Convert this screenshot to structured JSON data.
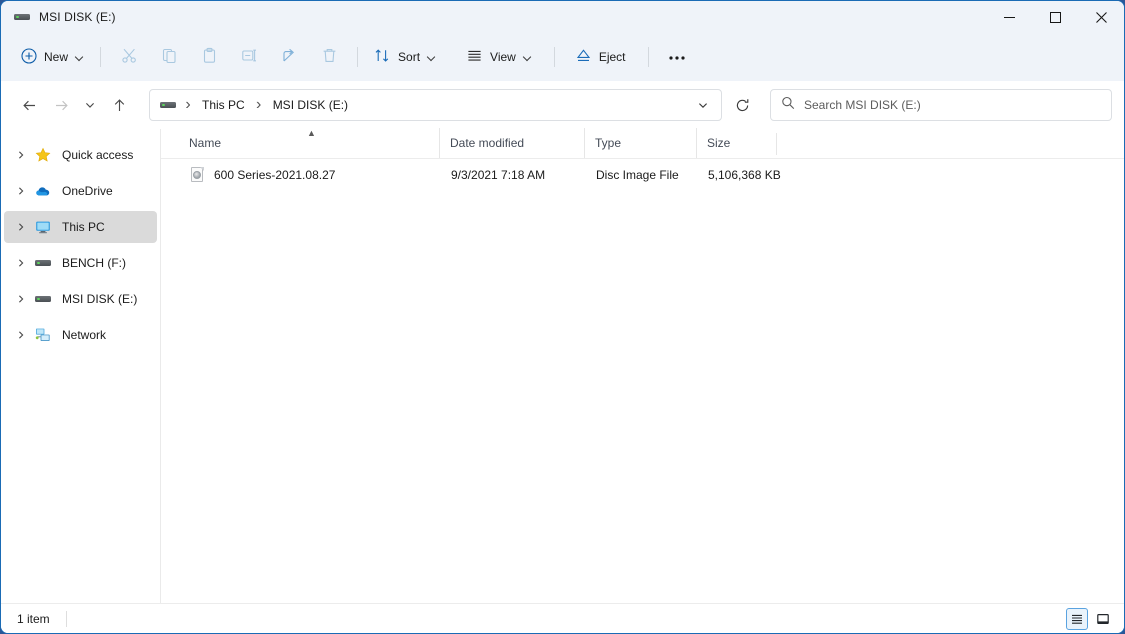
{
  "window": {
    "title": "MSI DISK (E:)",
    "title_icon": "drive-icon",
    "minimize_label": "Minimize",
    "maximize_label": "Maximize",
    "close_label": "Close"
  },
  "toolbar": {
    "new_label": "New",
    "new_icon": "plus-circle-icon",
    "cut_label": "Cut",
    "cut_icon": "scissors-icon",
    "copy_label": "Copy",
    "copy_icon": "copy-icon",
    "paste_label": "Paste",
    "paste_icon": "clipboard-icon",
    "rename_label": "Rename",
    "rename_icon": "rename-icon",
    "share_label": "Share",
    "share_icon": "share-icon",
    "delete_label": "Delete",
    "delete_icon": "trash-icon",
    "sort_label": "Sort",
    "sort_icon": "sort-arrows-icon",
    "view_label": "View",
    "view_icon": "lines-icon",
    "eject_label": "Eject",
    "eject_icon": "eject-icon",
    "more_label": "See more",
    "more_icon": "ellipsis-icon"
  },
  "address": {
    "back_icon": "arrow-left-icon",
    "forward_icon": "arrow-right-icon",
    "recent_icon": "chevron-down-icon",
    "up_icon": "arrow-up-icon",
    "crumb_icon": "drive-icon",
    "crumbs": [
      "This PC",
      "MSI DISK (E:)"
    ],
    "separator": "›",
    "dropdown_icon": "chevron-down-icon",
    "refresh_icon": "refresh-icon",
    "refresh_label": "Refresh"
  },
  "search": {
    "icon": "search-icon",
    "placeholder": "Search MSI DISK (E:)",
    "value": ""
  },
  "sidebar": {
    "items": [
      {
        "label": "Quick access",
        "icon": "star-icon",
        "expand_icon": "chevron-right-icon",
        "selected": false
      },
      {
        "label": "OneDrive",
        "icon": "cloud-icon",
        "expand_icon": "chevron-right-icon",
        "selected": false
      },
      {
        "label": "This PC",
        "icon": "monitor-icon",
        "expand_icon": "chevron-right-icon",
        "selected": true
      },
      {
        "label": "BENCH (F:)",
        "icon": "drive-icon",
        "expand_icon": "chevron-right-icon",
        "selected": false
      },
      {
        "label": "MSI DISK (E:)",
        "icon": "drive-icon",
        "expand_icon": "chevron-right-icon",
        "selected": false
      },
      {
        "label": "Network",
        "icon": "network-icon",
        "expand_icon": "chevron-right-icon",
        "selected": false
      }
    ]
  },
  "filelist": {
    "columns": [
      {
        "label": "Name",
        "sorted": "ascending",
        "sort_icon": "caret-up-icon"
      },
      {
        "label": "Date modified",
        "sorted": ""
      },
      {
        "label": "Type",
        "sorted": ""
      },
      {
        "label": "Size",
        "sorted": ""
      }
    ],
    "rows": [
      {
        "name": "600 Series-2021.08.27",
        "date_modified": "9/3/2021 7:18 AM",
        "type": "Disc Image File",
        "size": "5,106,368 KB",
        "icon": "disc-image-file-icon"
      }
    ]
  },
  "statusbar": {
    "item_count": "1 item",
    "details_view_icon": "details-view-icon",
    "details_view_label": "Details view",
    "details_view_active": true,
    "large_icons_view_icon": "large-icons-view-icon",
    "large_icons_view_label": "Large icons view",
    "large_icons_view_active": false
  },
  "colors": {
    "chrome": "#eff3f9",
    "accent": "#0078d4",
    "window_border": "#1a6bb5",
    "selection": "#dadada"
  }
}
